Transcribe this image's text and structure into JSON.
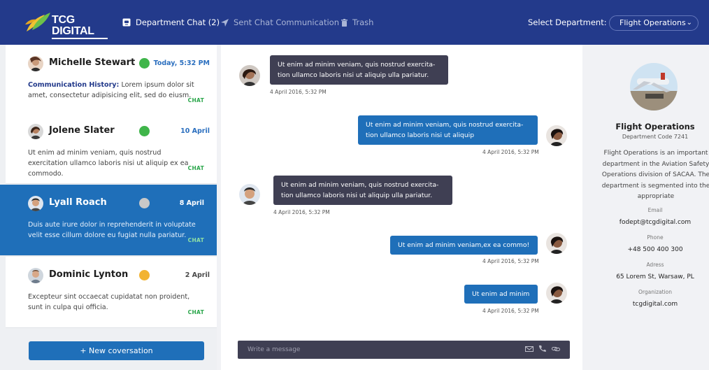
{
  "header": {
    "brand": "TCG DIGITAL",
    "nav": {
      "chat": "Department Chat (2)",
      "sent": "Sent Chat Communication",
      "trash": "Trash"
    },
    "select_label": "Select Department:",
    "select_value": "Flight Operations"
  },
  "contacts": [
    {
      "name": "Michelle Stewart",
      "status": "online",
      "status_color": "#3fb54a",
      "date": "Today, 5:32 PM",
      "history_label": "Communication History:",
      "message": "Lorem ipsum dolor sit amet, consectetur adipisicing elit, sed do eiusm.",
      "tag": "CHAT"
    },
    {
      "name": "Jolene Slater",
      "status": "online",
      "status_color": "#3fb54a",
      "date": "10 April",
      "message": "Ut enim ad minim veniam, quis nostrud exercitation ullamco laboris nisi ut aliquip ex ea commodo.",
      "tag": "CHAT"
    },
    {
      "name": "Lyall Roach",
      "status": "offline",
      "status_color": "#c8c8c8",
      "date": "8 April",
      "message": "Duis aute irure dolor in reprehenderit in voluptate velit esse cillum dolore eu fugiat nulla pariatur.",
      "tag": "CHAT"
    },
    {
      "name": "Dominic Lynton",
      "status": "away",
      "status_color": "#f2b331",
      "date": "2 April",
      "message": "Excepteur sint occaecat cupidatat non proident, sunt in culpa qui officia.",
      "tag": "CHAT"
    }
  ],
  "new_conversation": "+ New coversation",
  "messages": [
    {
      "direction": "in",
      "line1": "Ut enim ad minim veniam, quis nostrud exercita-",
      "line2": "tion ullamco laboris nisi ut aliquip ulla pariatur.",
      "time": "4 April 2016, 5:32 PM"
    },
    {
      "direction": "out",
      "line1": "Ut enim ad minim veniam, quis nostrud exercita-",
      "line2": "tion ullamco laboris nisi ut aliquip",
      "time": "4 April 2016, 5:32 PM"
    },
    {
      "direction": "in",
      "line1": "Ut enim ad minim veniam, quis nostrud exercita-",
      "line2": "tion ullamco laboris nisi ut aliquip ulla pariatur.",
      "time": "4 April 2016, 5:32 PM"
    },
    {
      "direction": "out",
      "line1": "Ut enim ad minim veniam,ex ea commo!",
      "time": "4 April 2016, 5:32 PM"
    },
    {
      "direction": "out",
      "line1": "Ut enim ad minim",
      "time": "4 April 2016, 5:32 PM"
    }
  ],
  "compose": {
    "placeholder": "Write a message"
  },
  "department": {
    "name": "Flight Operations",
    "code": "Department Code 7241",
    "description": "Flight Operations is an important department in the Aviation Safety Operations division of SACAA. The department is segmented into the appropriate",
    "email_label": "Email",
    "email": "fodept@tcgdigital.com",
    "phone_label": "Phone",
    "phone": "+48 500 400 300",
    "address_label": "Adress",
    "address": "65 Lorem St, Warsaw, PL",
    "org_label": "Organization",
    "org": "tcgdigital.com"
  },
  "colors": {
    "header": "#233a8b",
    "primary": "#1f6fb9",
    "incoming_bubble": "#3f3f53",
    "chat_tag": "#2aa64a"
  }
}
